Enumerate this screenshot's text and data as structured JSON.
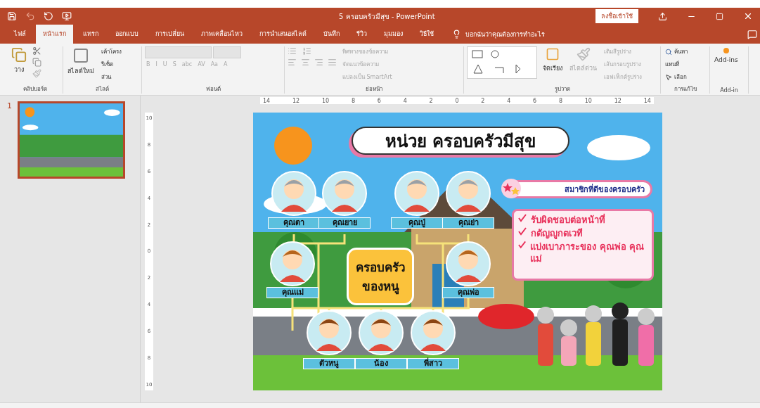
{
  "window": {
    "title": "5 ครอบครัวมีสุข  -  PowerPoint",
    "sign_in": "ลงชื่อเข้าใช้"
  },
  "tabs": [
    {
      "label": "ไฟล์",
      "selected": false
    },
    {
      "label": "หน้าแรก",
      "selected": true
    },
    {
      "label": "แทรก",
      "selected": false
    },
    {
      "label": "ออกแบบ",
      "selected": false
    },
    {
      "label": "การเปลี่ยน",
      "selected": false
    },
    {
      "label": "ภาพเคลื่อนไหว",
      "selected": false
    },
    {
      "label": "การนำเสนอสไลด์",
      "selected": false
    },
    {
      "label": "บันทึก",
      "selected": false
    },
    {
      "label": "รีวิว",
      "selected": false
    },
    {
      "label": "มุมมอง",
      "selected": false
    },
    {
      "label": "วิธีใช้",
      "selected": false
    }
  ],
  "tell_me": "บอกฉันว่าคุณต้องการทำอะไร",
  "ribbon": [
    {
      "kind": "clipboard",
      "label": "คลิปบอร์ด",
      "items": [
        {
          "label": "วาง",
          "disabled": false
        }
      ]
    },
    {
      "kind": "slides",
      "label": "สไลด์",
      "items": [
        {
          "label": "สไลด์ใหม่",
          "disabled": false
        },
        {
          "label": "เค้าโครง",
          "disabled": false
        },
        {
          "label": "รีเซ็ต",
          "disabled": false
        },
        {
          "label": "ส่วน",
          "disabled": false
        }
      ]
    },
    {
      "kind": "font",
      "label": "ฟอนต์",
      "items": [
        {
          "label": "B",
          "disabled": true
        },
        {
          "label": "I",
          "disabled": true
        },
        {
          "label": "U",
          "disabled": true
        },
        {
          "label": "S",
          "disabled": true
        },
        {
          "label": "abc",
          "disabled": true
        },
        {
          "label": "AV",
          "disabled": true
        },
        {
          "label": "Aa",
          "disabled": true
        },
        {
          "label": "A",
          "disabled": true
        }
      ]
    },
    {
      "kind": "paragraph",
      "label": "ย่อหน้า",
      "items": [
        {
          "label": "ทิศทางของข้อความ",
          "disabled": true
        },
        {
          "label": "จัดแนวข้อความ",
          "disabled": true
        },
        {
          "label": "แปลงเป็น SmartArt",
          "disabled": true
        }
      ]
    },
    {
      "kind": "drawing",
      "label": "รูปวาด",
      "items": [
        {
          "label": "จัดเรียง",
          "disabled": false
        },
        {
          "label": "สไตล์ด่วน",
          "disabled": true
        },
        {
          "label": "เติมสีรูปร่าง",
          "disabled": true
        },
        {
          "label": "เส้นกรอบรูปร่าง",
          "disabled": true
        },
        {
          "label": "เอฟเฟ็กต์รูปร่าง",
          "disabled": true
        }
      ]
    },
    {
      "kind": "editing",
      "label": "การแก้ไข",
      "items": [
        {
          "label": "ค้นหา",
          "disabled": false
        },
        {
          "label": "แทนที่",
          "disabled": false
        },
        {
          "label": "เลือก",
          "disabled": false
        }
      ]
    },
    {
      "kind": "addins",
      "label": "Add-in",
      "items": [
        {
          "label": "Add-ins",
          "disabled": false
        }
      ]
    }
  ],
  "thumbnails": [
    {
      "number": "1",
      "selected": true
    }
  ],
  "ruler": {
    "horizontal": [
      "14",
      "12",
      "10",
      "8",
      "6",
      "4",
      "2",
      "0",
      "2",
      "4",
      "6",
      "8",
      "10",
      "12",
      "14"
    ],
    "vertical": [
      "10",
      "8",
      "6",
      "4",
      "2",
      "0",
      "2",
      "4",
      "6",
      "8",
      "10"
    ]
  },
  "slide": {
    "title": "หน่วย ครอบครัวมีสุข",
    "center": [
      "ครอบครัว",
      "ของหนู"
    ],
    "grandparents": [
      "คุณตา",
      "คุณยาย",
      "คุณปู่",
      "คุณย่า"
    ],
    "parents": [
      "คุณแม่",
      "คุณพ่อ"
    ],
    "children": [
      "ตัวหนู",
      "น้อง",
      "พี่สาว"
    ],
    "good_member_heading": "สมาชิกที่ดีของครอบครัว",
    "checklist": [
      "รับผิดชอบต่อหน้าที่",
      "กตัญญูกตเวที",
      "แบ่งเบาภาระของ คุณพ่อ คุณแม่"
    ]
  }
}
